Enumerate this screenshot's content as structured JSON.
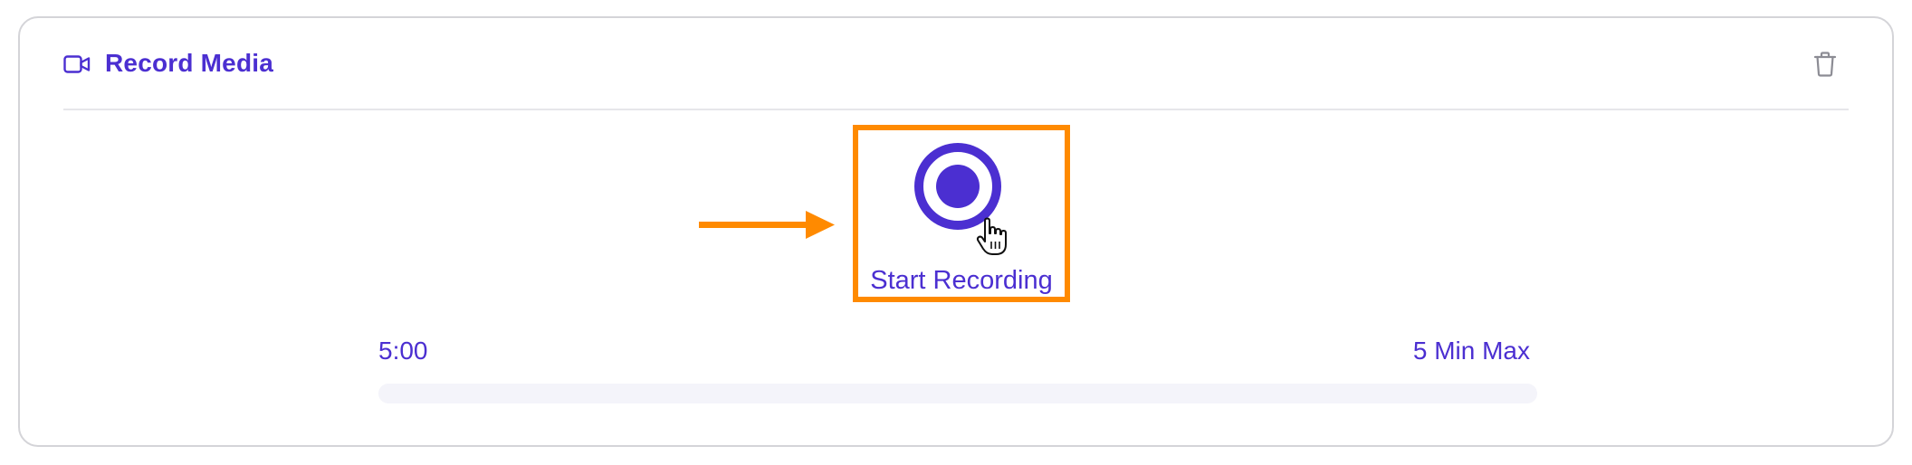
{
  "panel": {
    "title": "Record Media",
    "title_icon": "video-camera-icon",
    "delete_icon": "trash-icon"
  },
  "recorder": {
    "button_label": "Start Recording",
    "button_icon": "record-icon",
    "time_remaining": "5:00",
    "max_duration_label": "5 Min Max",
    "progress": 0
  },
  "annotation": {
    "highlight_color": "#ff8a00"
  },
  "colors": {
    "accent": "#4b2fd1",
    "border": "#d4d4d8",
    "track": "#f4f4fa"
  }
}
